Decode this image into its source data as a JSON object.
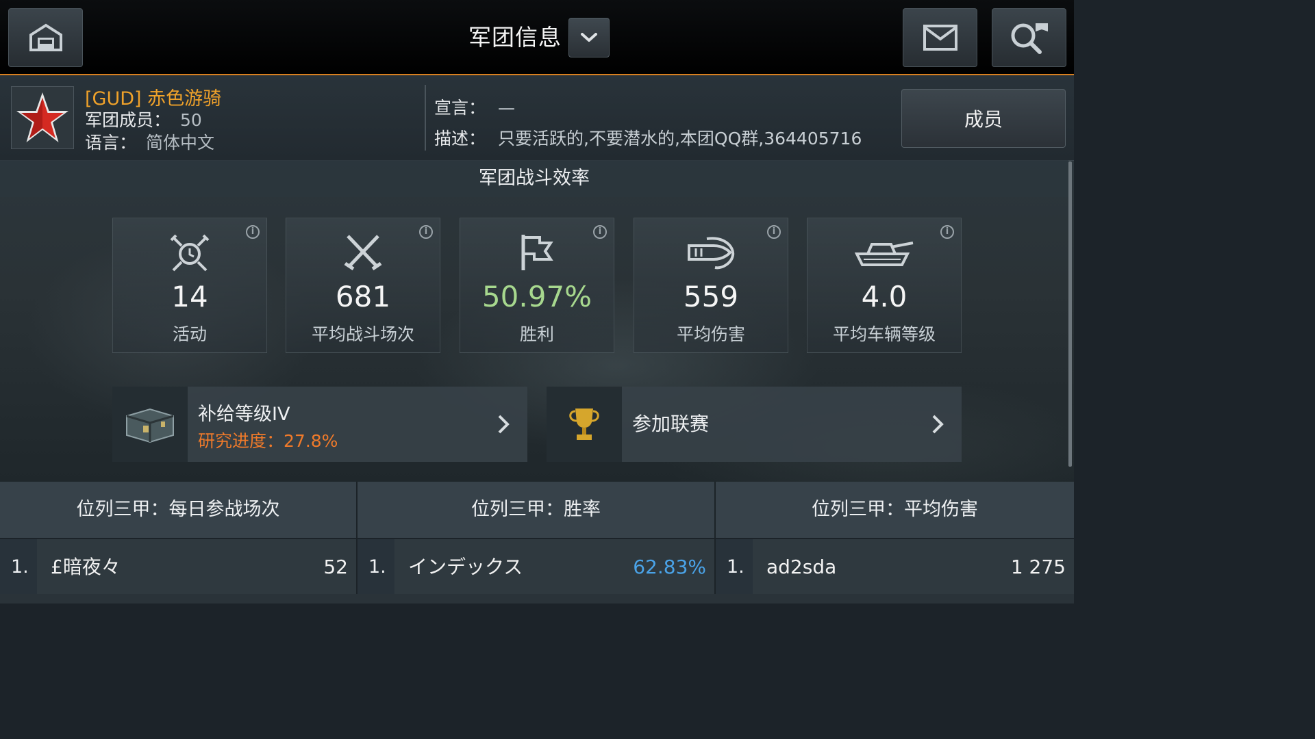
{
  "topbar": {
    "title": "军团信息",
    "home_icon": "garage-home-icon",
    "mail_icon": "mail-icon",
    "search_icon": "search-clan-icon"
  },
  "clan": {
    "name": "[GUD] 赤色游骑",
    "members_label": "军团成员：",
    "members_value": "50",
    "language_label": "语言：",
    "language_value": "简体中文",
    "declaration_label": "宣言：",
    "declaration_value": "—",
    "description_label": "描述：",
    "description_value": "只要活跃的,不要潜水的,本团QQ群,364405716",
    "members_button": "成员",
    "emblem_icon": "red-star-icon"
  },
  "efficiency": {
    "title": "军团战斗效率",
    "stats": [
      {
        "value": "14",
        "label": "活动",
        "icon": "activity-icon"
      },
      {
        "value": "681",
        "label": "平均战斗场次",
        "icon": "crossed-swords-icon"
      },
      {
        "value": "50.97%",
        "label": "胜利",
        "icon": "flag-icon"
      },
      {
        "value": "559",
        "label": "平均伤害",
        "icon": "shell-icon"
      },
      {
        "value": "4.0",
        "label": "平均车辆等级",
        "icon": "tank-icon"
      }
    ],
    "colors": {
      "win": "#a7d88e",
      "accent": "#f0a22a",
      "progress": "#f07a2a"
    }
  },
  "supply": {
    "title": "补给等级IV",
    "progress_label": "研究进度：",
    "progress_value": "27.8%"
  },
  "league": {
    "title": "参加联赛"
  },
  "ranks": [
    {
      "header": "位列三甲：每日参战场次",
      "num": "1.",
      "name": "£暗夜々",
      "value": "52"
    },
    {
      "header": "位列三甲：胜率",
      "num": "1.",
      "name": "インデックス",
      "value": "62.83%"
    },
    {
      "header": "位列三甲：平均伤害",
      "num": "1.",
      "name": "ad2sda",
      "value": "1 275"
    }
  ]
}
